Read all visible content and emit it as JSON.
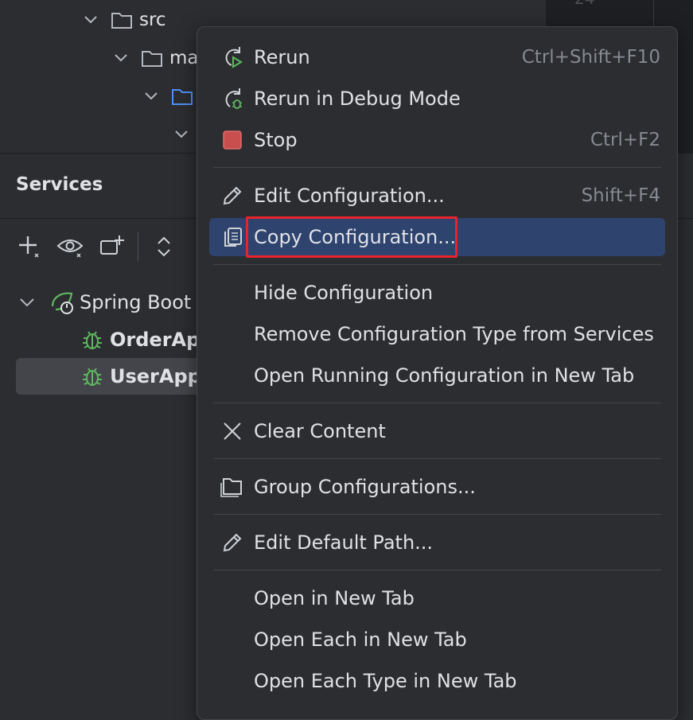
{
  "project_tree": {
    "items": [
      {
        "label": "src"
      },
      {
        "label": "ma"
      }
    ],
    "editor_line_number": "24"
  },
  "services": {
    "title": "Services",
    "group_label": "Spring Boot",
    "apps": [
      {
        "label": "OrderApp"
      },
      {
        "label": "UserAppl"
      }
    ]
  },
  "context_menu": {
    "items": [
      {
        "label": "Rerun",
        "shortcut": "Ctrl+Shift+F10",
        "icon": "rerun-icon"
      },
      {
        "label": "Rerun in Debug Mode",
        "shortcut": "",
        "icon": "rerun-debug-icon"
      },
      {
        "label": "Stop",
        "shortcut": "Ctrl+F2",
        "icon": "stop-icon"
      },
      {
        "label": "Edit Configuration...",
        "shortcut": "Shift+F4",
        "icon": "pencil-icon"
      },
      {
        "label": "Copy Configuration...",
        "shortcut": "",
        "icon": "copy-icon"
      },
      {
        "label": "Hide Configuration",
        "shortcut": ""
      },
      {
        "label": "Remove Configuration Type from Services",
        "shortcut": ""
      },
      {
        "label": "Open Running Configuration in New Tab",
        "shortcut": ""
      },
      {
        "label": "Clear Content",
        "shortcut": "",
        "icon": "close-icon"
      },
      {
        "label": "Group Configurations...",
        "shortcut": "",
        "icon": "folder-group-icon"
      },
      {
        "label": "Edit Default Path...",
        "shortcut": "",
        "icon": "pencil-icon"
      },
      {
        "label": "Open in New Tab",
        "shortcut": ""
      },
      {
        "label": "Open Each in New Tab",
        "shortcut": ""
      },
      {
        "label": "Open Each Type in New Tab",
        "shortcut": ""
      }
    ],
    "highlighted_item": "Copy Configuration..."
  },
  "colors": {
    "background": "#2b2d30",
    "menu_selection": "#2e436e",
    "highlight_box": "#e8232b",
    "spring_green": "#5fb85f",
    "stop_red": "#c94f4f"
  }
}
